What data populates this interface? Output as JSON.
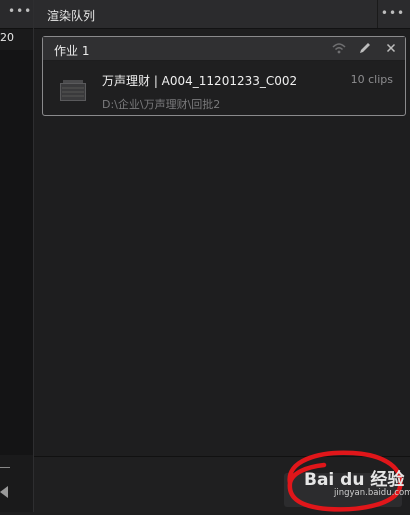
{
  "left_panel": {
    "menu_dots": "•••",
    "fragment_text": "20"
  },
  "render_queue": {
    "title": "渲染队列",
    "menu_dots": "•••",
    "job": {
      "title": "作业 1",
      "name": "万声理财 | A004_11201233_C002",
      "path": "D:\\企业\\万声理财\\回批2",
      "clips": "10 clips",
      "icons": [
        "wifi-icon",
        "pencil-icon",
        "close-icon"
      ]
    }
  },
  "watermark": {
    "logo_text": "Bai du 经验",
    "sub_text": "jingyan.baidu.com"
  },
  "colors": {
    "background": "#1e1e1f",
    "header": "#2b2b2d",
    "card_border": "#8a8a8c",
    "annotation_red": "#e0161a"
  }
}
